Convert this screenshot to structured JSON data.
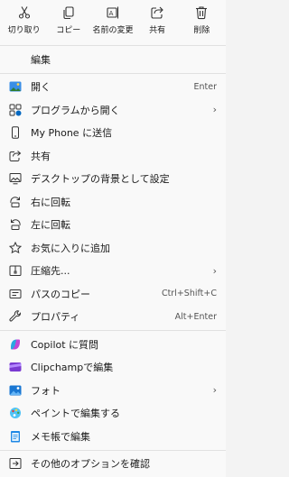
{
  "toolbar": {
    "cut": "切り取り",
    "copy": "コピー",
    "rename": "名前の変更",
    "share": "共有",
    "delete": "削除"
  },
  "edit_label": "編集",
  "items": {
    "open": {
      "label": "開く",
      "shortcut": "Enter"
    },
    "open_with": {
      "label": "プログラムから開く"
    },
    "phone": {
      "label": "My Phone に送信"
    },
    "share": {
      "label": "共有"
    },
    "wallpaper": {
      "label": "デスクトップの背景として設定"
    },
    "rotate_right": {
      "label": "右に回転"
    },
    "rotate_left": {
      "label": "左に回転"
    },
    "favorite": {
      "label": "お気に入りに追加"
    },
    "compress": {
      "label": "圧縮先..."
    },
    "copy_path": {
      "label": "パスのコピー",
      "shortcut": "Ctrl+Shift+C"
    },
    "properties": {
      "label": "プロパティ",
      "shortcut": "Alt+Enter"
    },
    "copilot": {
      "label": "Copilot に質問"
    },
    "clipchamp": {
      "label": "Clipchampで編集"
    },
    "photos": {
      "label": "フォト"
    },
    "paint": {
      "label": "ペイントで編集する"
    },
    "notepad": {
      "label": "メモ帳で編集"
    },
    "more": {
      "label": "その他のオプションを確認"
    }
  },
  "colors": {
    "accent": "#0067c0",
    "background": "#f9f9f9"
  }
}
